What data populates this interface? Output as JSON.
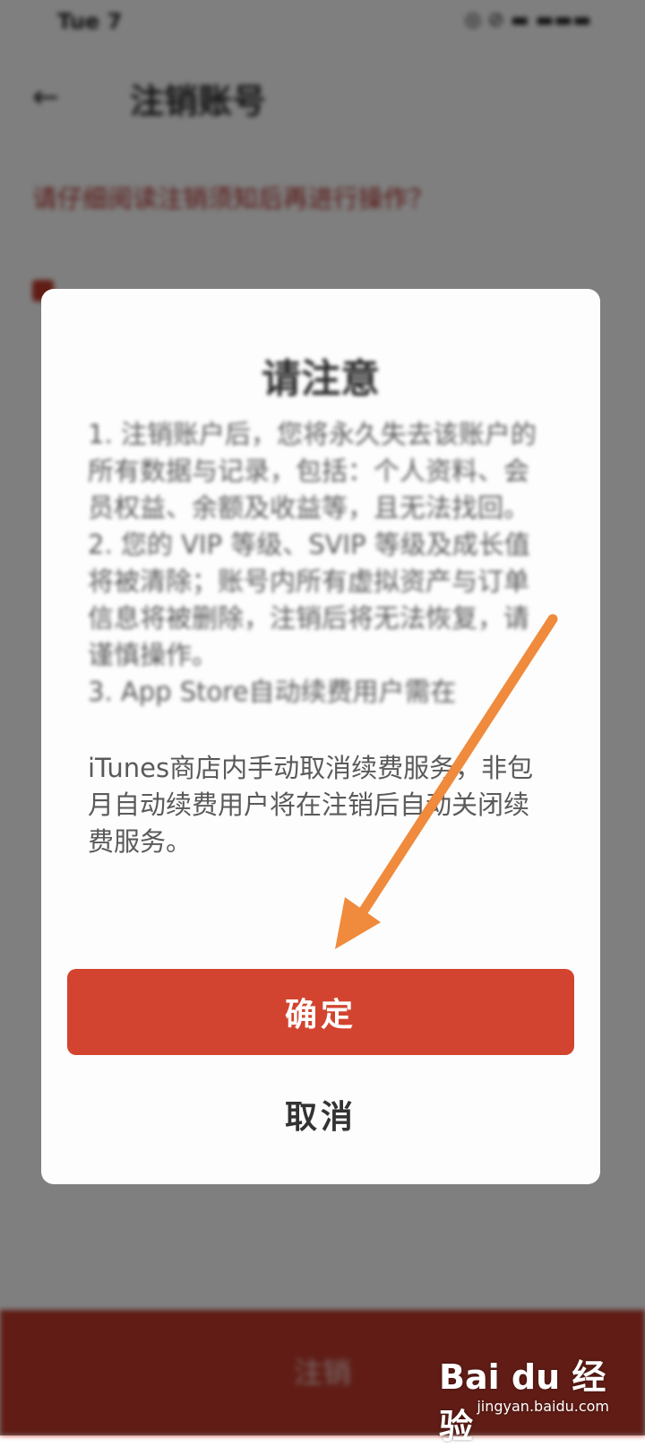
{
  "status_bar": {
    "time": "Tue 7",
    "right": "◎ ⊘ ▬ ▬▬▬"
  },
  "header": {
    "title": "注销账号"
  },
  "warning": "请仔细阅读注销须知后再进行操作？",
  "bottom_bar": {
    "label": "注销"
  },
  "dialog": {
    "title": "请注意",
    "body": [
      "1. 注销账户后，您将永久失去该账户的所有数据与记录，包括：个人资料、会员权益、余额及收益等，且无法找回。",
      "2. 您的 VIP 等级、SVIP 等级及成长值将被清除；账号内所有虚拟资产与订单信息将被删除，注销后将无法恢复，请谨慎操作。",
      "3. App Store自动续费用户需在"
    ],
    "body_clear": "iTunes商店内手动取消续费服务，非包月自动续费用户将在注销后自动关闭续费服务。",
    "confirm_label": "确定",
    "cancel_label": "取消"
  },
  "watermark": {
    "brand": "Bai du 经验",
    "url": "jingyan.baidu.com"
  },
  "colors": {
    "accent": "#d2442f",
    "arrow": "#f08a3c"
  }
}
